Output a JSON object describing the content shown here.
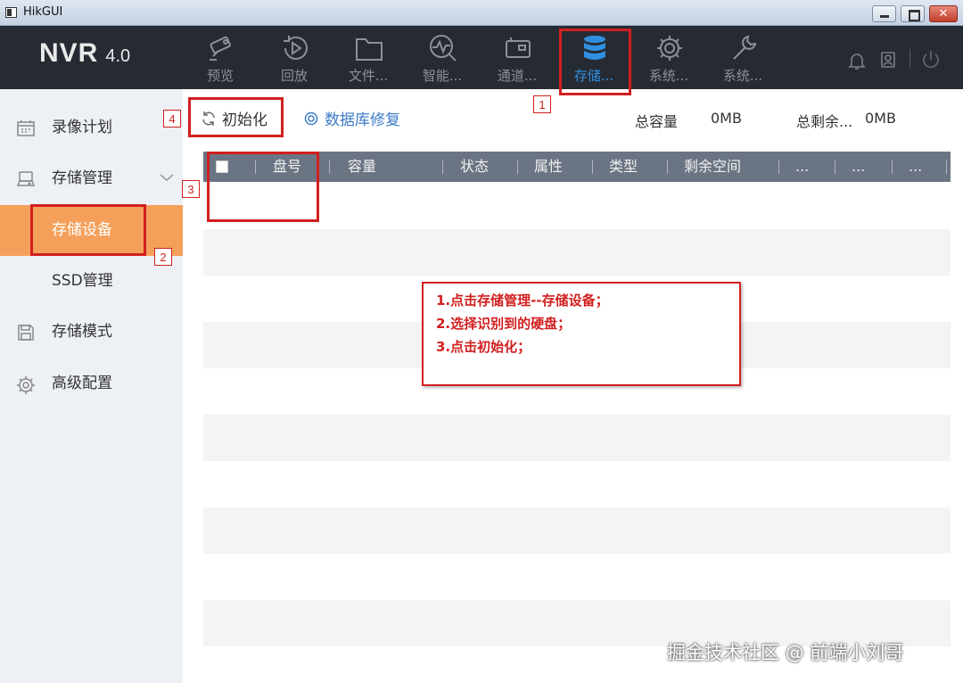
{
  "window": {
    "title": "HikGUI",
    "close_glyph": "✕"
  },
  "header": {
    "logo": "NVR",
    "version": "4.0",
    "nav": [
      {
        "label": "预览",
        "icon": "camera-icon"
      },
      {
        "label": "回放",
        "icon": "playback-icon"
      },
      {
        "label": "文件...",
        "icon": "folder-icon"
      },
      {
        "label": "智能...",
        "icon": "smart-analysis-icon"
      },
      {
        "label": "通道...",
        "icon": "channel-icon"
      },
      {
        "label": "存储...",
        "icon": "database-icon",
        "active": true
      },
      {
        "label": "系统...",
        "icon": "gear-icon"
      },
      {
        "label": "系统...",
        "icon": "wrench-icon"
      }
    ],
    "right_icons": [
      "bell-icon",
      "user-icon",
      "power-icon"
    ]
  },
  "sidebar": {
    "items": [
      {
        "label": "录像计划",
        "icon": "calendar-icon"
      },
      {
        "label": "存储管理",
        "icon": "hdd-icon",
        "expanded": true
      },
      {
        "label": "存储设备",
        "active": true
      },
      {
        "label": "SSD管理"
      },
      {
        "label": "存储模式",
        "icon": "save-icon"
      },
      {
        "label": "高级配置",
        "icon": "settings-icon"
      }
    ]
  },
  "toolbar": {
    "init_label": "初始化",
    "db_repair_label": "数据库修复",
    "total_capacity_label": "总容量",
    "total_capacity_value": "0MB",
    "total_free_label": "总剩余...",
    "total_free_value": "0MB"
  },
  "table": {
    "columns": [
      "盘号",
      "容量",
      "状态",
      "属性",
      "类型",
      "剩余空间",
      "...",
      "...",
      "..."
    ],
    "rows": []
  },
  "annotations": {
    "markers": [
      "1",
      "2",
      "3",
      "4"
    ],
    "note_lines": [
      "1.点击存储管理--存储设备；",
      "2.选择识别到的硬盘；",
      "3.点击初始化；"
    ]
  },
  "watermark": "掘金技术社区 @ 前端小刘哥",
  "colors": {
    "header_bg": "#262b33",
    "active_nav": "#2f8fe0",
    "sidebar_active": "#f4a05b",
    "annotation_red": "#d21f1f",
    "table_header": "#6b7483"
  }
}
